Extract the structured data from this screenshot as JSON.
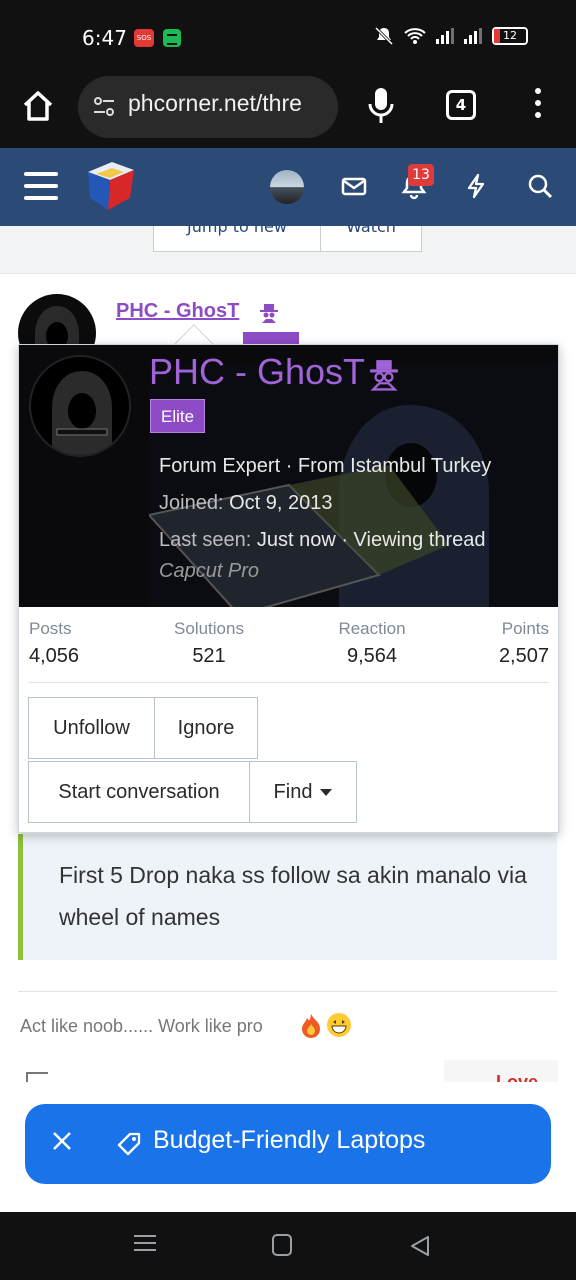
{
  "status_bar": {
    "time": "6:47",
    "sos_label": "SOS",
    "battery": "12"
  },
  "browser": {
    "url": "phcorner.net/thre",
    "tab_count": "4"
  },
  "site_header": {
    "notification_count": "13"
  },
  "thread_controls": {
    "jump_label": "Jump to new",
    "watch_label": "Watch"
  },
  "post": {
    "username": "PHC - GhosT",
    "quote_text": "First 5 Drop naka ss follow sa akin manalo via wheel of names",
    "signature": "Act like noob...... Work like pro",
    "reaction_label": "Love"
  },
  "member_card": {
    "name": "PHC - GhosT",
    "badge": "Elite",
    "title_line": "Forum Expert · From Istambul Turkey",
    "joined_label": "Joined:",
    "joined_value": "Oct 9, 2013",
    "last_seen_label": "Last seen:",
    "last_seen_value": "Just now · Viewing thread",
    "activity_detail": "Capcut Pro",
    "stats": [
      {
        "label": "Posts",
        "value": "4,056"
      },
      {
        "label": "Solutions",
        "value": "521"
      },
      {
        "label": "Reaction",
        "value": "9,564"
      },
      {
        "label": "Points",
        "value": "2,507"
      }
    ],
    "buttons": {
      "unfollow": "Unfollow",
      "ignore": "Ignore",
      "start_conversation": "Start conversation",
      "find": "Find"
    }
  },
  "ad_bar": {
    "label": "Budget-Friendly Laptops"
  },
  "colors": {
    "header_blue": "#2b4a75",
    "username_purple": "#8e4bc6",
    "ad_blue": "#1a73e8",
    "quote_accent": "#8fbf3c"
  },
  "icons": [
    "home-icon",
    "site-settings-icon",
    "mic-icon",
    "more-vert-icon",
    "hamburger-icon",
    "site-logo",
    "envelope-icon",
    "bell-icon",
    "bolt-icon",
    "search-icon",
    "spy-icon",
    "close-icon",
    "tag-icon"
  ]
}
